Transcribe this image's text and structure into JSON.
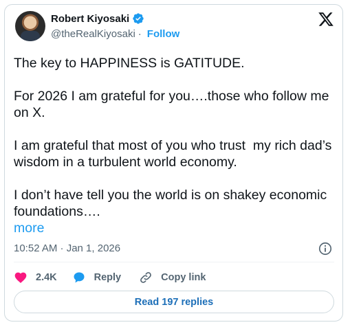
{
  "author": {
    "name": "Robert Kiyosaki",
    "handle": "@theRealKiyosaki",
    "separator": "·",
    "follow_label": "Follow"
  },
  "tweet": {
    "paragraphs": [
      "The key to HAPPINESS is GATITUDE.",
      "For 2026 I am grateful for you….those who follow me on X.",
      "I am grateful that most of you who trust  my rich dad’s wisdom in a turbulent world economy.",
      "I don’t have tell you the world is on shakey economic foundations…."
    ],
    "more_label": "more",
    "timestamp": "10:52 AM · Jan 1, 2026"
  },
  "actions": {
    "likes": "2.4K",
    "reply_label": "Reply",
    "copy_link_label": "Copy link"
  },
  "read_replies_label": "Read 197 replies",
  "colors": {
    "accent": "#1d9bf0",
    "like": "#f91880",
    "text_secondary": "#536471"
  },
  "icons": [
    "verified-badge-icon",
    "x-logo-icon",
    "info-icon",
    "heart-icon",
    "reply-bubble-icon",
    "link-icon"
  ]
}
